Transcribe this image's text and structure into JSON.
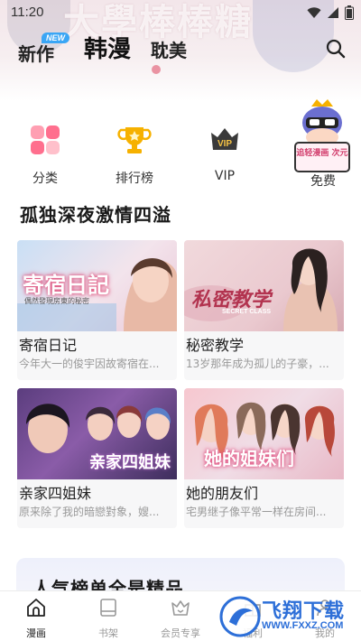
{
  "status_bar": {
    "time": "11:20"
  },
  "hero": {
    "watermark_text": "大學棒棒糖"
  },
  "top_nav": {
    "tabs": [
      {
        "label": "新作",
        "badge": "NEW"
      },
      {
        "label": "韩漫"
      },
      {
        "label": "耽美"
      }
    ]
  },
  "quick_menu": {
    "items": [
      {
        "label": "分类",
        "icon": "category-icon"
      },
      {
        "label": "排行榜",
        "icon": "trophy-icon"
      },
      {
        "label": "VIP",
        "icon": "vip-crown-icon",
        "icon_text": "VIP"
      }
    ],
    "promo": {
      "label": "免费",
      "sign_text": "追轻漫画 次元"
    }
  },
  "section": {
    "title": "孤独深夜激情四溢"
  },
  "comics": [
    {
      "title": "寄宿日记",
      "desc": "今年大一的俊宇因故寄宿在...",
      "cover_title": "寄宿日記",
      "cover_subtitle": "偶然發現房東的秘密"
    },
    {
      "title": "秘密教学",
      "desc": "13岁那年成为孤儿的子豪，...",
      "cover_title": "私密教学",
      "cover_subtitle": "SECRET CLASS"
    },
    {
      "title": "亲家四姐妹",
      "desc": "原来除了我的暗戀對象，嫂...",
      "cover_title": "亲家四姐妹"
    },
    {
      "title": "她的朋友们",
      "desc": "宅男继子像平常一样在房间...",
      "cover_title": "她的姐妹们"
    }
  ],
  "ranking": {
    "title": "人气榜单全是精品"
  },
  "tabbar": {
    "tabs": [
      {
        "label": "漫画",
        "active": true
      },
      {
        "label": "书架"
      },
      {
        "label": "会员专享"
      },
      {
        "label": "福利"
      },
      {
        "label": "我的"
      }
    ]
  },
  "watermark": {
    "text": "飞翔下载",
    "url": "WWW.FXXZ.COM"
  },
  "colors": {
    "accent": "#3aa6f5",
    "brand_gold": "#f6b100",
    "watermark_blue": "#2d6fd8"
  }
}
